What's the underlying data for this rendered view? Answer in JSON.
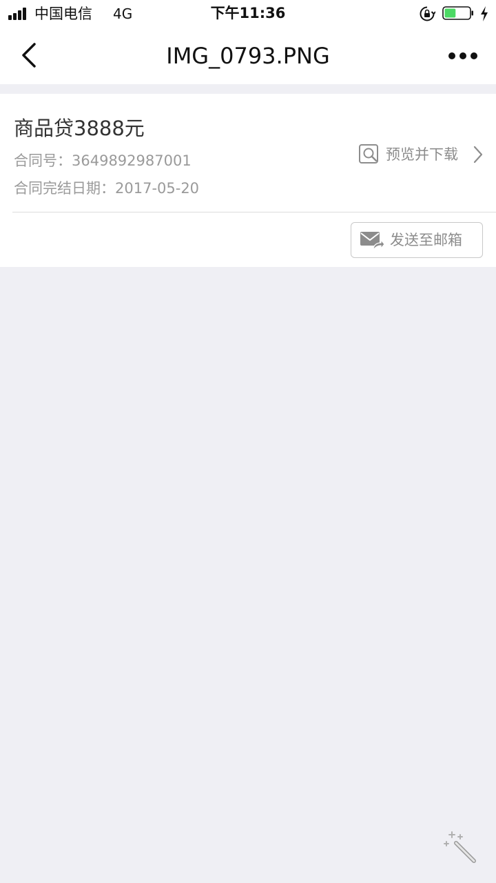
{
  "status_bar": {
    "carrier": "中国电信",
    "network": "4G",
    "time": "下午11:36",
    "battery_level": 0.45,
    "icons": [
      "signal-icon",
      "orientation-lock-icon",
      "battery-icon",
      "charging-bolt-icon"
    ]
  },
  "nav": {
    "title": "IMG_0793.PNG",
    "icons": [
      "back-chevron-icon",
      "more-dots-icon"
    ]
  },
  "card": {
    "title": "商品贷3888元",
    "contract_no": "合同号：3649892987001",
    "end_date": "合同完结日期：2017-05-20",
    "preview_label": "预览并下载",
    "send_email_label": "发送至邮箱",
    "icons": [
      "preview-search-icon",
      "chevron-right-icon",
      "mail-forward-icon"
    ]
  },
  "floating": {
    "icon": "magic-wand-icon"
  },
  "colors": {
    "background": "#efeff4",
    "card": "#ffffff",
    "text_primary": "#333333",
    "text_secondary": "#9a9a9a",
    "battery_fill": "#4cd964"
  }
}
